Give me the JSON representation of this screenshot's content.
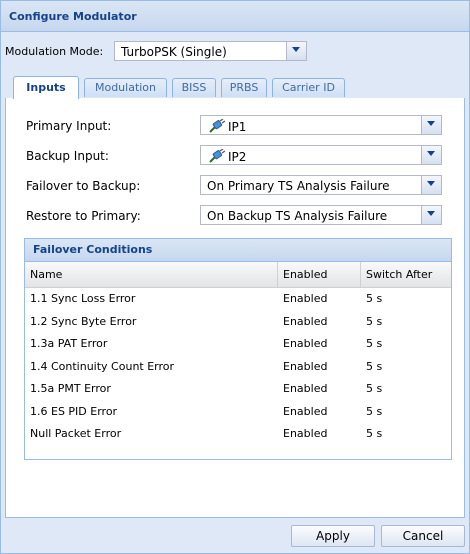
{
  "window": {
    "title": "Configure Modulator"
  },
  "modulation": {
    "label": "Modulation Mode:",
    "value": "TurboPSK (Single)"
  },
  "tabs": [
    {
      "label": "Inputs",
      "active": true
    },
    {
      "label": "Modulation"
    },
    {
      "label": "BISS"
    },
    {
      "label": "PRBS"
    },
    {
      "label": "Carrier ID"
    }
  ],
  "inputs": {
    "primary": {
      "label": "Primary Input:",
      "value": "IP1",
      "icon": "plug-icon"
    },
    "backup": {
      "label": "Backup Input:",
      "value": "IP2",
      "icon": "plug-icon"
    },
    "failover": {
      "label": "Failover to Backup:",
      "value": "On Primary TS Analysis Failure"
    },
    "restore": {
      "label": "Restore to Primary:",
      "value": "On Backup TS Analysis Failure"
    }
  },
  "failover_conditions": {
    "title": "Failover Conditions",
    "columns": [
      "Name",
      "Enabled",
      "Switch After"
    ],
    "rows": [
      {
        "name": "1.1 Sync Loss Error",
        "enabled": "Enabled",
        "switch_after": "5 s"
      },
      {
        "name": "1.2 Sync Byte Error",
        "enabled": "Enabled",
        "switch_after": "5 s"
      },
      {
        "name": "1.3a PAT Error",
        "enabled": "Enabled",
        "switch_after": "5 s"
      },
      {
        "name": "1.4 Continuity Count Error",
        "enabled": "Enabled",
        "switch_after": "5 s"
      },
      {
        "name": "1.5a PMT Error",
        "enabled": "Enabled",
        "switch_after": "5 s"
      },
      {
        "name": "1.6 ES PID Error",
        "enabled": "Enabled",
        "switch_after": "5 s"
      },
      {
        "name": "Null Packet Error",
        "enabled": "Enabled",
        "switch_after": "5 s"
      }
    ]
  },
  "buttons": {
    "apply": "Apply",
    "cancel": "Cancel"
  },
  "colors": {
    "title_text": "#15428b",
    "border": "#99bbe8",
    "background": "#dfe8f6"
  }
}
